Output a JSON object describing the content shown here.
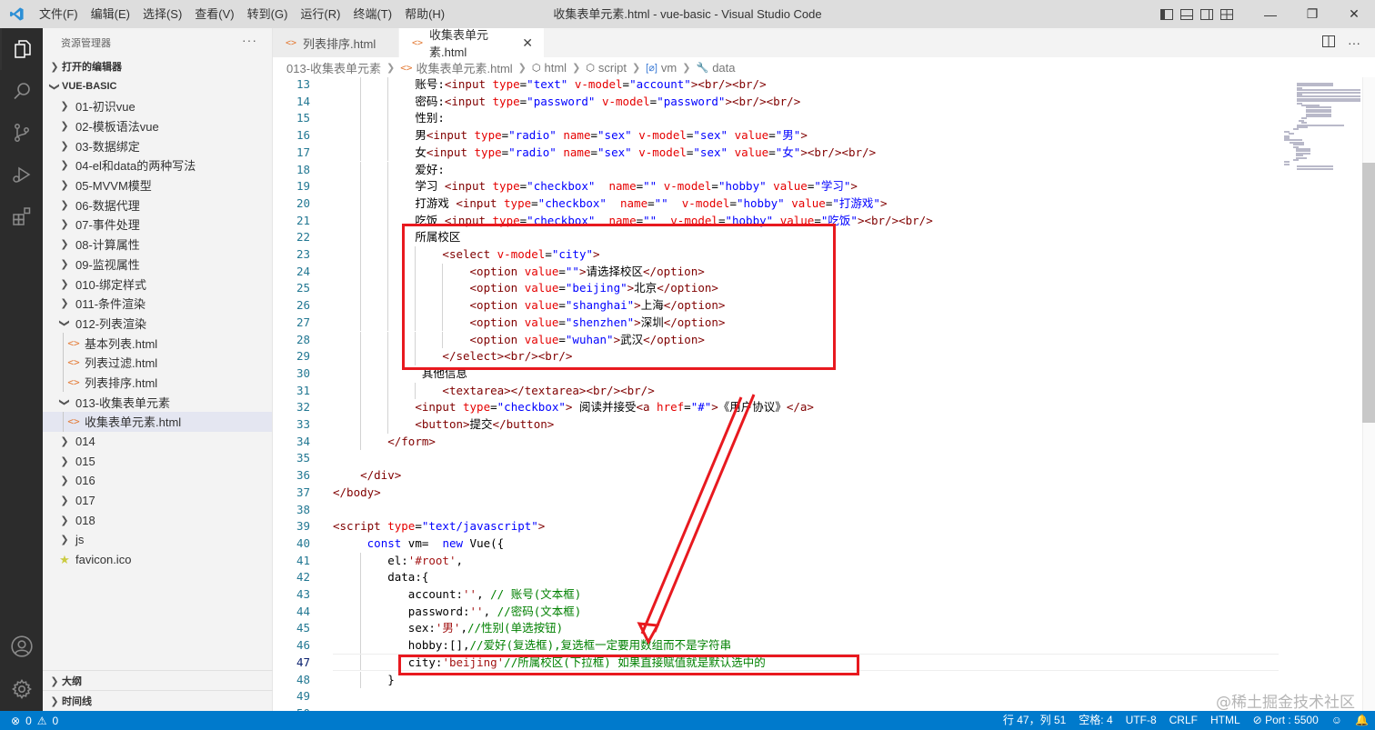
{
  "window": {
    "title": "收集表单元素.html - vue-basic - Visual Studio Code",
    "menu": [
      "文件(F)",
      "编辑(E)",
      "选择(S)",
      "查看(V)",
      "转到(G)",
      "运行(R)",
      "终端(T)",
      "帮助(H)"
    ]
  },
  "sidebar": {
    "header": "资源管理器",
    "open_editors": "打开的编辑器",
    "workspace": "VUE-BASIC",
    "outline": "大纲",
    "timeline": "时间线",
    "tree": [
      {
        "label": "01-初识vue",
        "type": "folder",
        "depth": 1
      },
      {
        "label": "02-模板语法vue",
        "type": "folder",
        "depth": 1
      },
      {
        "label": "03-数据绑定",
        "type": "folder",
        "depth": 1
      },
      {
        "label": "04-el和data的两种写法",
        "type": "folder",
        "depth": 1
      },
      {
        "label": "05-MVVM模型",
        "type": "folder",
        "depth": 1
      },
      {
        "label": "06-数据代理",
        "type": "folder",
        "depth": 1
      },
      {
        "label": "07-事件处理",
        "type": "folder",
        "depth": 1
      },
      {
        "label": "08-计算属性",
        "type": "folder",
        "depth": 1
      },
      {
        "label": "09-监视属性",
        "type": "folder",
        "depth": 1
      },
      {
        "label": "010-绑定样式",
        "type": "folder",
        "depth": 1
      },
      {
        "label": "011-条件渲染",
        "type": "folder",
        "depth": 1
      },
      {
        "label": "012-列表渲染",
        "type": "folder-open",
        "depth": 1
      },
      {
        "label": "基本列表.html",
        "type": "html",
        "depth": 2
      },
      {
        "label": "列表过滤.html",
        "type": "html",
        "depth": 2
      },
      {
        "label": "列表排序.html",
        "type": "html",
        "depth": 2
      },
      {
        "label": "013-收集表单元素",
        "type": "folder-open",
        "depth": 1
      },
      {
        "label": "收集表单元素.html",
        "type": "html",
        "depth": 2,
        "selected": true
      },
      {
        "label": "014",
        "type": "folder",
        "depth": 1
      },
      {
        "label": "015",
        "type": "folder",
        "depth": 1
      },
      {
        "label": "016",
        "type": "folder",
        "depth": 1
      },
      {
        "label": "017",
        "type": "folder",
        "depth": 1
      },
      {
        "label": "018",
        "type": "folder",
        "depth": 1
      },
      {
        "label": "js",
        "type": "folder",
        "depth": 1
      },
      {
        "label": "favicon.ico",
        "type": "ico",
        "depth": 1
      }
    ]
  },
  "tabs": [
    {
      "label": "列表排序.html",
      "active": false
    },
    {
      "label": "收集表单元素.html",
      "active": true
    }
  ],
  "breadcrumbs": [
    "013-收集表单元素",
    "收集表单元素.html",
    "html",
    "script",
    "vm",
    "data"
  ],
  "editor": {
    "current_line": 47,
    "lines": [
      {
        "n": 13,
        "indent": 12,
        "tokens": [
          [
            "t",
            "账号:"
          ],
          [
            "tag",
            "<input "
          ],
          [
            "attr",
            "type"
          ],
          [
            "t",
            "="
          ],
          [
            "val",
            "\"text\""
          ],
          [
            "t",
            " "
          ],
          [
            "attr",
            "v-model"
          ],
          [
            "t",
            "="
          ],
          [
            "val",
            "\"account\""
          ],
          [
            "tag",
            "><br/><br/>"
          ]
        ]
      },
      {
        "n": 14,
        "indent": 12,
        "tokens": [
          [
            "t",
            "密码:"
          ],
          [
            "tag",
            "<input "
          ],
          [
            "attr",
            "type"
          ],
          [
            "t",
            "="
          ],
          [
            "val",
            "\"password\""
          ],
          [
            "t",
            " "
          ],
          [
            "attr",
            "v-model"
          ],
          [
            "t",
            "="
          ],
          [
            "val",
            "\"password\""
          ],
          [
            "tag",
            "><br/><br/>"
          ]
        ]
      },
      {
        "n": 15,
        "indent": 12,
        "tokens": [
          [
            "t",
            "性别:"
          ]
        ]
      },
      {
        "n": 16,
        "indent": 12,
        "tokens": [
          [
            "t",
            "男"
          ],
          [
            "tag",
            "<input "
          ],
          [
            "attr",
            "type"
          ],
          [
            "t",
            "="
          ],
          [
            "val",
            "\"radio\""
          ],
          [
            "t",
            " "
          ],
          [
            "attr",
            "name"
          ],
          [
            "t",
            "="
          ],
          [
            "val",
            "\"sex\""
          ],
          [
            "t",
            " "
          ],
          [
            "attr",
            "v-model"
          ],
          [
            "t",
            "="
          ],
          [
            "val",
            "\"sex\""
          ],
          [
            "t",
            " "
          ],
          [
            "attr",
            "value"
          ],
          [
            "t",
            "="
          ],
          [
            "val",
            "\"男\""
          ],
          [
            "tag",
            ">"
          ]
        ]
      },
      {
        "n": 17,
        "indent": 12,
        "tokens": [
          [
            "t",
            "女"
          ],
          [
            "tag",
            "<input "
          ],
          [
            "attr",
            "type"
          ],
          [
            "t",
            "="
          ],
          [
            "val",
            "\"radio\""
          ],
          [
            "t",
            " "
          ],
          [
            "attr",
            "name"
          ],
          [
            "t",
            "="
          ],
          [
            "val",
            "\"sex\""
          ],
          [
            "t",
            " "
          ],
          [
            "attr",
            "v-model"
          ],
          [
            "t",
            "="
          ],
          [
            "val",
            "\"sex\""
          ],
          [
            "t",
            " "
          ],
          [
            "attr",
            "value"
          ],
          [
            "t",
            "="
          ],
          [
            "val",
            "\"女\""
          ],
          [
            "tag",
            "><br/><br/>"
          ]
        ]
      },
      {
        "n": 18,
        "indent": 12,
        "tokens": [
          [
            "t",
            "爱好:"
          ]
        ]
      },
      {
        "n": 19,
        "indent": 12,
        "tokens": [
          [
            "t",
            "学习 "
          ],
          [
            "tag",
            "<input "
          ],
          [
            "attr",
            "type"
          ],
          [
            "t",
            "="
          ],
          [
            "val",
            "\"checkbox\""
          ],
          [
            "t",
            "  "
          ],
          [
            "attr",
            "name"
          ],
          [
            "t",
            "="
          ],
          [
            "val",
            "\"\""
          ],
          [
            "t",
            " "
          ],
          [
            "attr",
            "v-model"
          ],
          [
            "t",
            "="
          ],
          [
            "val",
            "\"hobby\""
          ],
          [
            "t",
            " "
          ],
          [
            "attr",
            "value"
          ],
          [
            "t",
            "="
          ],
          [
            "val",
            "\"学习\""
          ],
          [
            "tag",
            ">"
          ]
        ]
      },
      {
        "n": 20,
        "indent": 12,
        "tokens": [
          [
            "t",
            "打游戏 "
          ],
          [
            "tag",
            "<input "
          ],
          [
            "attr",
            "type"
          ],
          [
            "t",
            "="
          ],
          [
            "val",
            "\"checkbox\""
          ],
          [
            "t",
            "  "
          ],
          [
            "attr",
            "name"
          ],
          [
            "t",
            "="
          ],
          [
            "val",
            "\"\""
          ],
          [
            "t",
            "  "
          ],
          [
            "attr",
            "v-model"
          ],
          [
            "t",
            "="
          ],
          [
            "val",
            "\"hobby\""
          ],
          [
            "t",
            " "
          ],
          [
            "attr",
            "value"
          ],
          [
            "t",
            "="
          ],
          [
            "val",
            "\"打游戏\""
          ],
          [
            "tag",
            ">"
          ]
        ]
      },
      {
        "n": 21,
        "indent": 12,
        "tokens": [
          [
            "t",
            "吃饭 "
          ],
          [
            "tag",
            "<input "
          ],
          [
            "attr",
            "type"
          ],
          [
            "t",
            "="
          ],
          [
            "val",
            "\"checkbox\""
          ],
          [
            "t",
            "  "
          ],
          [
            "attr",
            "name"
          ],
          [
            "t",
            "="
          ],
          [
            "val",
            "\"\""
          ],
          [
            "t",
            "  "
          ],
          [
            "attr",
            "v-model"
          ],
          [
            "t",
            "="
          ],
          [
            "val",
            "\"hobby\""
          ],
          [
            "t",
            " "
          ],
          [
            "attr",
            "value"
          ],
          [
            "t",
            "="
          ],
          [
            "val",
            "\"吃饭\""
          ],
          [
            "tag",
            "><br/><br/>"
          ]
        ]
      },
      {
        "n": 22,
        "indent": 12,
        "tokens": [
          [
            "t",
            "所属校区"
          ]
        ]
      },
      {
        "n": 23,
        "indent": 16,
        "tokens": [
          [
            "tag",
            "<select "
          ],
          [
            "attr",
            "v-model"
          ],
          [
            "t",
            "="
          ],
          [
            "val",
            "\"city\""
          ],
          [
            "tag",
            ">"
          ]
        ]
      },
      {
        "n": 24,
        "indent": 20,
        "tokens": [
          [
            "tag",
            "<option "
          ],
          [
            "attr",
            "value"
          ],
          [
            "t",
            "="
          ],
          [
            "val",
            "\"\""
          ],
          [
            "tag",
            ">"
          ],
          [
            "t",
            "请选择校区"
          ],
          [
            "tag",
            "</option>"
          ]
        ]
      },
      {
        "n": 25,
        "indent": 20,
        "tokens": [
          [
            "tag",
            "<option "
          ],
          [
            "attr",
            "value"
          ],
          [
            "t",
            "="
          ],
          [
            "val",
            "\"beijing\""
          ],
          [
            "tag",
            ">"
          ],
          [
            "t",
            "北京"
          ],
          [
            "tag",
            "</option>"
          ]
        ]
      },
      {
        "n": 26,
        "indent": 20,
        "tokens": [
          [
            "tag",
            "<option "
          ],
          [
            "attr",
            "value"
          ],
          [
            "t",
            "="
          ],
          [
            "val",
            "\"shanghai\""
          ],
          [
            "tag",
            ">"
          ],
          [
            "t",
            "上海"
          ],
          [
            "tag",
            "</option>"
          ]
        ]
      },
      {
        "n": 27,
        "indent": 20,
        "tokens": [
          [
            "tag",
            "<option "
          ],
          [
            "attr",
            "value"
          ],
          [
            "t",
            "="
          ],
          [
            "val",
            "\"shenzhen\""
          ],
          [
            "tag",
            ">"
          ],
          [
            "t",
            "深圳"
          ],
          [
            "tag",
            "</option>"
          ]
        ]
      },
      {
        "n": 28,
        "indent": 20,
        "tokens": [
          [
            "tag",
            "<option "
          ],
          [
            "attr",
            "value"
          ],
          [
            "t",
            "="
          ],
          [
            "val",
            "\"wuhan\""
          ],
          [
            "tag",
            ">"
          ],
          [
            "t",
            "武汉"
          ],
          [
            "tag",
            "</option>"
          ]
        ]
      },
      {
        "n": 29,
        "indent": 16,
        "tokens": [
          [
            "tag",
            "</select><br/><br/>"
          ]
        ]
      },
      {
        "n": 30,
        "indent": 13,
        "tokens": [
          [
            "t",
            "其他信息"
          ]
        ]
      },
      {
        "n": 31,
        "indent": 16,
        "tokens": [
          [
            "tag",
            "<textarea></textarea><br/><br/>"
          ]
        ]
      },
      {
        "n": 32,
        "indent": 12,
        "tokens": [
          [
            "tag",
            "<input "
          ],
          [
            "attr",
            "type"
          ],
          [
            "t",
            "="
          ],
          [
            "val",
            "\"checkbox\""
          ],
          [
            "tag",
            ">"
          ],
          [
            "t",
            " 阅读并接受"
          ],
          [
            "tag",
            "<a "
          ],
          [
            "attr",
            "href"
          ],
          [
            "t",
            "="
          ],
          [
            "val",
            "\"#\""
          ],
          [
            "tag",
            ">"
          ],
          [
            "t",
            "《用户协议》"
          ],
          [
            "tag",
            "</a>"
          ]
        ]
      },
      {
        "n": 33,
        "indent": 12,
        "tokens": [
          [
            "tag",
            "<button>"
          ],
          [
            "t",
            "提交"
          ],
          [
            "tag",
            "</button>"
          ]
        ]
      },
      {
        "n": 34,
        "indent": 8,
        "tokens": [
          [
            "tag",
            "</form>"
          ]
        ]
      },
      {
        "n": 35,
        "indent": 0,
        "tokens": []
      },
      {
        "n": 36,
        "indent": 4,
        "tokens": [
          [
            "tag",
            "</div>"
          ]
        ]
      },
      {
        "n": 37,
        "indent": 0,
        "tokens": [
          [
            "tag",
            "</body>"
          ]
        ]
      },
      {
        "n": 38,
        "indent": 0,
        "tokens": []
      },
      {
        "n": 39,
        "indent": 0,
        "tokens": [
          [
            "tag",
            "<script "
          ],
          [
            "attr",
            "type"
          ],
          [
            "t",
            "="
          ],
          [
            "val",
            "\"text/javascript\""
          ],
          [
            "tag",
            ">"
          ]
        ]
      },
      {
        "n": 40,
        "indent": 5,
        "tokens": [
          [
            "kw",
            "const"
          ],
          [
            "t",
            " vm=  "
          ],
          [
            "kw",
            "new"
          ],
          [
            "t",
            " Vue({"
          ]
        ]
      },
      {
        "n": 41,
        "indent": 8,
        "tokens": [
          [
            "t",
            "el:"
          ],
          [
            "str",
            "'#root'"
          ],
          [
            "t",
            ","
          ]
        ]
      },
      {
        "n": 42,
        "indent": 8,
        "tokens": [
          [
            "t",
            "data:{"
          ]
        ]
      },
      {
        "n": 43,
        "indent": 11,
        "tokens": [
          [
            "t",
            "account:"
          ],
          [
            "str",
            "''"
          ],
          [
            "t",
            ", "
          ],
          [
            "cmt",
            "// 账号(文本框)"
          ]
        ]
      },
      {
        "n": 44,
        "indent": 11,
        "tokens": [
          [
            "t",
            "password:"
          ],
          [
            "str",
            "''"
          ],
          [
            "t",
            ", "
          ],
          [
            "cmt",
            "//密码(文本框)"
          ]
        ]
      },
      {
        "n": 45,
        "indent": 11,
        "tokens": [
          [
            "t",
            "sex:"
          ],
          [
            "str",
            "'男'"
          ],
          [
            "t",
            ","
          ],
          [
            "cmt",
            "//性别(单选按钮)"
          ]
        ]
      },
      {
        "n": 46,
        "indent": 11,
        "tokens": [
          [
            "t",
            "hobby:[],"
          ],
          [
            "cmt",
            "//爱好(复选框),复选框一定要用数组而不是字符串"
          ]
        ]
      },
      {
        "n": 47,
        "indent": 11,
        "tokens": [
          [
            "t",
            "city:"
          ],
          [
            "str",
            "'beijing'"
          ],
          [
            "cmt",
            "//所属校区(下拉框) 如果直接赋值就是默认选中的"
          ]
        ]
      },
      {
        "n": 48,
        "indent": 8,
        "tokens": [
          [
            "t",
            "}"
          ]
        ]
      },
      {
        "n": 49,
        "indent": 0,
        "tokens": []
      },
      {
        "n": 50,
        "indent": 0,
        "tokens": []
      }
    ]
  },
  "status": {
    "errors": "0",
    "warnings": "0",
    "position": "行 47，列 51",
    "spaces": "空格: 4",
    "encoding": "UTF-8",
    "eol": "CRLF",
    "language": "HTML",
    "port": "Port : 5500"
  },
  "watermark": "@稀土掘金技术社区",
  "colors": {
    "statusbar": "#007acc",
    "activitybar": "#2c2c2c",
    "annotation": "#e8191f",
    "tag": "#800000",
    "attr": "#e50000",
    "value": "#0000ff",
    "string": "#a31515",
    "comment": "#008000"
  }
}
